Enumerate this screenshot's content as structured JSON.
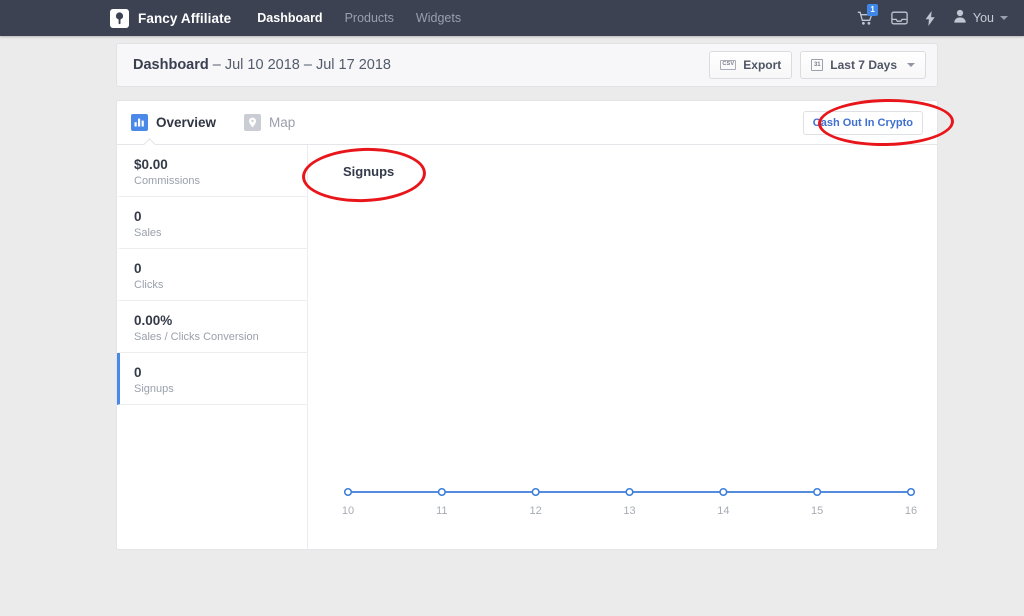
{
  "navbar": {
    "logo_icon": "pin-logo-icon",
    "brand": "Fancy Affiliate",
    "links": [
      {
        "label": "Dashboard",
        "active": true
      },
      {
        "label": "Products",
        "active": false
      },
      {
        "label": "Widgets",
        "active": false
      }
    ],
    "cart_icon": "shopping-cart-icon",
    "cart_badge": "1",
    "inbox_icon": "inbox-icon",
    "bolt_icon": "lightning-bolt-icon",
    "user_icon": "person-icon",
    "user_label": "You",
    "user_caret_icon": "chevron-down-icon"
  },
  "header": {
    "title_bold": "Dashboard",
    "title_rest": " – Jul 10 2018 – Jul 17 2018",
    "export_icon": "CSV",
    "export_label": "Export",
    "date_icon": "31",
    "date_label": "Last 7 Days",
    "date_caret_icon": "chevron-down-icon"
  },
  "tabs": [
    {
      "label": "Overview",
      "icon": "bar-chart-icon",
      "active": true
    },
    {
      "label": "Map",
      "icon": "map-pin-icon",
      "active": false
    }
  ],
  "crypto_button": {
    "label": "Cash Out In Crypto"
  },
  "metrics": [
    {
      "value": "$0.00",
      "label": "Commissions",
      "active": false
    },
    {
      "value": "0",
      "label": "Sales",
      "active": false
    },
    {
      "value": "0",
      "label": "Clicks",
      "active": false
    },
    {
      "value": "0.00%",
      "label": "Sales / Clicks Conversion",
      "active": false
    },
    {
      "value": "0",
      "label": "Signups",
      "active": true
    }
  ],
  "annotations": [
    {
      "name": "signups-title-circle",
      "color": "#e8161a"
    },
    {
      "name": "crypto-button-circle",
      "color": "#e8161a"
    }
  ],
  "colors": {
    "navbar_bg": "#3d4252",
    "page_bg": "#ebebeb",
    "accent_blue": "#4a89e8",
    "line_blue": "#3b7dd8",
    "annotation_red": "#e8161a"
  },
  "chart_data": {
    "type": "line",
    "title": "Signups",
    "xlabel": "",
    "ylabel": "",
    "x": [
      10,
      11,
      12,
      13,
      14,
      15,
      16
    ],
    "categories": [
      "10",
      "11",
      "12",
      "13",
      "14",
      "15",
      "16"
    ],
    "values": [
      0,
      0,
      0,
      0,
      0,
      0,
      0
    ],
    "series": [
      {
        "name": "Signups",
        "values": [
          0,
          0,
          0,
          0,
          0,
          0,
          0
        ],
        "color": "#3b7dd8"
      }
    ],
    "ylim": [
      0,
      1
    ],
    "grid": false,
    "legend": false,
    "markers": "hollow-circle"
  }
}
